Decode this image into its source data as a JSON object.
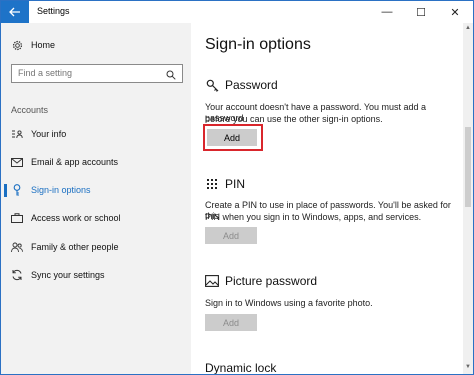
{
  "window": {
    "title": "Settings",
    "minimize_glyph": "—",
    "maximize_glyph": "☐",
    "close_glyph": "✕"
  },
  "sidebar": {
    "home": {
      "label": "Home",
      "icon": "gear-icon"
    },
    "search": {
      "placeholder": "Find a setting",
      "icon": "search-icon"
    },
    "section": "Accounts",
    "items": [
      {
        "label": "Your info",
        "icon": "person-card-icon"
      },
      {
        "label": "Email & app accounts",
        "icon": "mail-icon"
      },
      {
        "label": "Sign-in options",
        "icon": "key-icon",
        "active": true
      },
      {
        "label": "Access work or school",
        "icon": "briefcase-icon"
      },
      {
        "label": "Family & other people",
        "icon": "people-icon"
      },
      {
        "label": "Sync your settings",
        "icon": "sync-icon"
      }
    ]
  },
  "main": {
    "title": "Sign-in options",
    "password": {
      "heading": "Password",
      "description_line1": "Your account doesn't have a password. You must add a password",
      "description_line2": "before you can use the other sign-in options.",
      "button": "Add"
    },
    "pin": {
      "heading": "PIN",
      "description_line1": "Create a PIN to use in place of passwords. You'll be asked for this",
      "description_line2": "PIN when you sign in to Windows, apps, and services.",
      "button": "Add"
    },
    "picture_password": {
      "heading": "Picture password",
      "description": "Sign in to Windows using a favorite photo.",
      "button": "Add"
    },
    "dynamic_lock": {
      "heading": "Dynamic lock"
    }
  },
  "colors": {
    "accent": "#1a6fc2",
    "highlight": "#d9262c",
    "sidebar_bg": "#f2f2f2"
  }
}
